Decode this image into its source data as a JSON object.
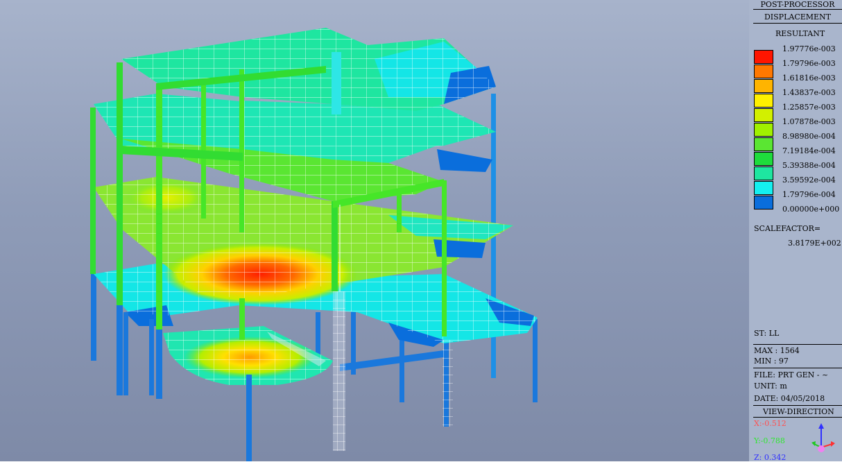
{
  "panel": {
    "header1": "POST-PROCESSOR",
    "header2": "DISPLACEMENT",
    "result_type": "RESULTANT",
    "legend": [
      {
        "label": "1.97776e-003",
        "color": "#ff1500"
      },
      {
        "label": "1.79796e-003",
        "color": "#ff7800"
      },
      {
        "label": "1.61816e-003",
        "color": "#ffb400"
      },
      {
        "label": "1.43837e-003",
        "color": "#fff000"
      },
      {
        "label": "1.25857e-003",
        "color": "#d2f000"
      },
      {
        "label": "1.07878e-003",
        "color": "#a0f000"
      },
      {
        "label": "8.98980e-004",
        "color": "#5ae632"
      },
      {
        "label": "7.19184e-004",
        "color": "#1edc3c"
      },
      {
        "label": "5.39388e-004",
        "color": "#1ee6a0"
      },
      {
        "label": "3.59592e-004",
        "color": "#14f0f0"
      },
      {
        "label": "1.79796e-004",
        "color": "#0a6edc"
      },
      {
        "label": "0.00000e+000",
        "color": ""
      }
    ],
    "scalefactor_label": "SCALEFACTOR=",
    "scalefactor_value": "3.8179E+002",
    "st": "ST: LL",
    "max": "MAX : 1564",
    "min": "MIN : 97",
    "file": "FILE: PRT GEN - ~",
    "unit": "UNIT: m",
    "date": "DATE: 04/05/2018",
    "view_header": "VIEW-DIRECTION",
    "view_x": "X:-0.512",
    "view_y": "Y:-0.788",
    "view_z": "Z: 0.342",
    "colors": {
      "x": "#ff5050",
      "y": "#2ee82e",
      "z": "#3030ff"
    }
  }
}
